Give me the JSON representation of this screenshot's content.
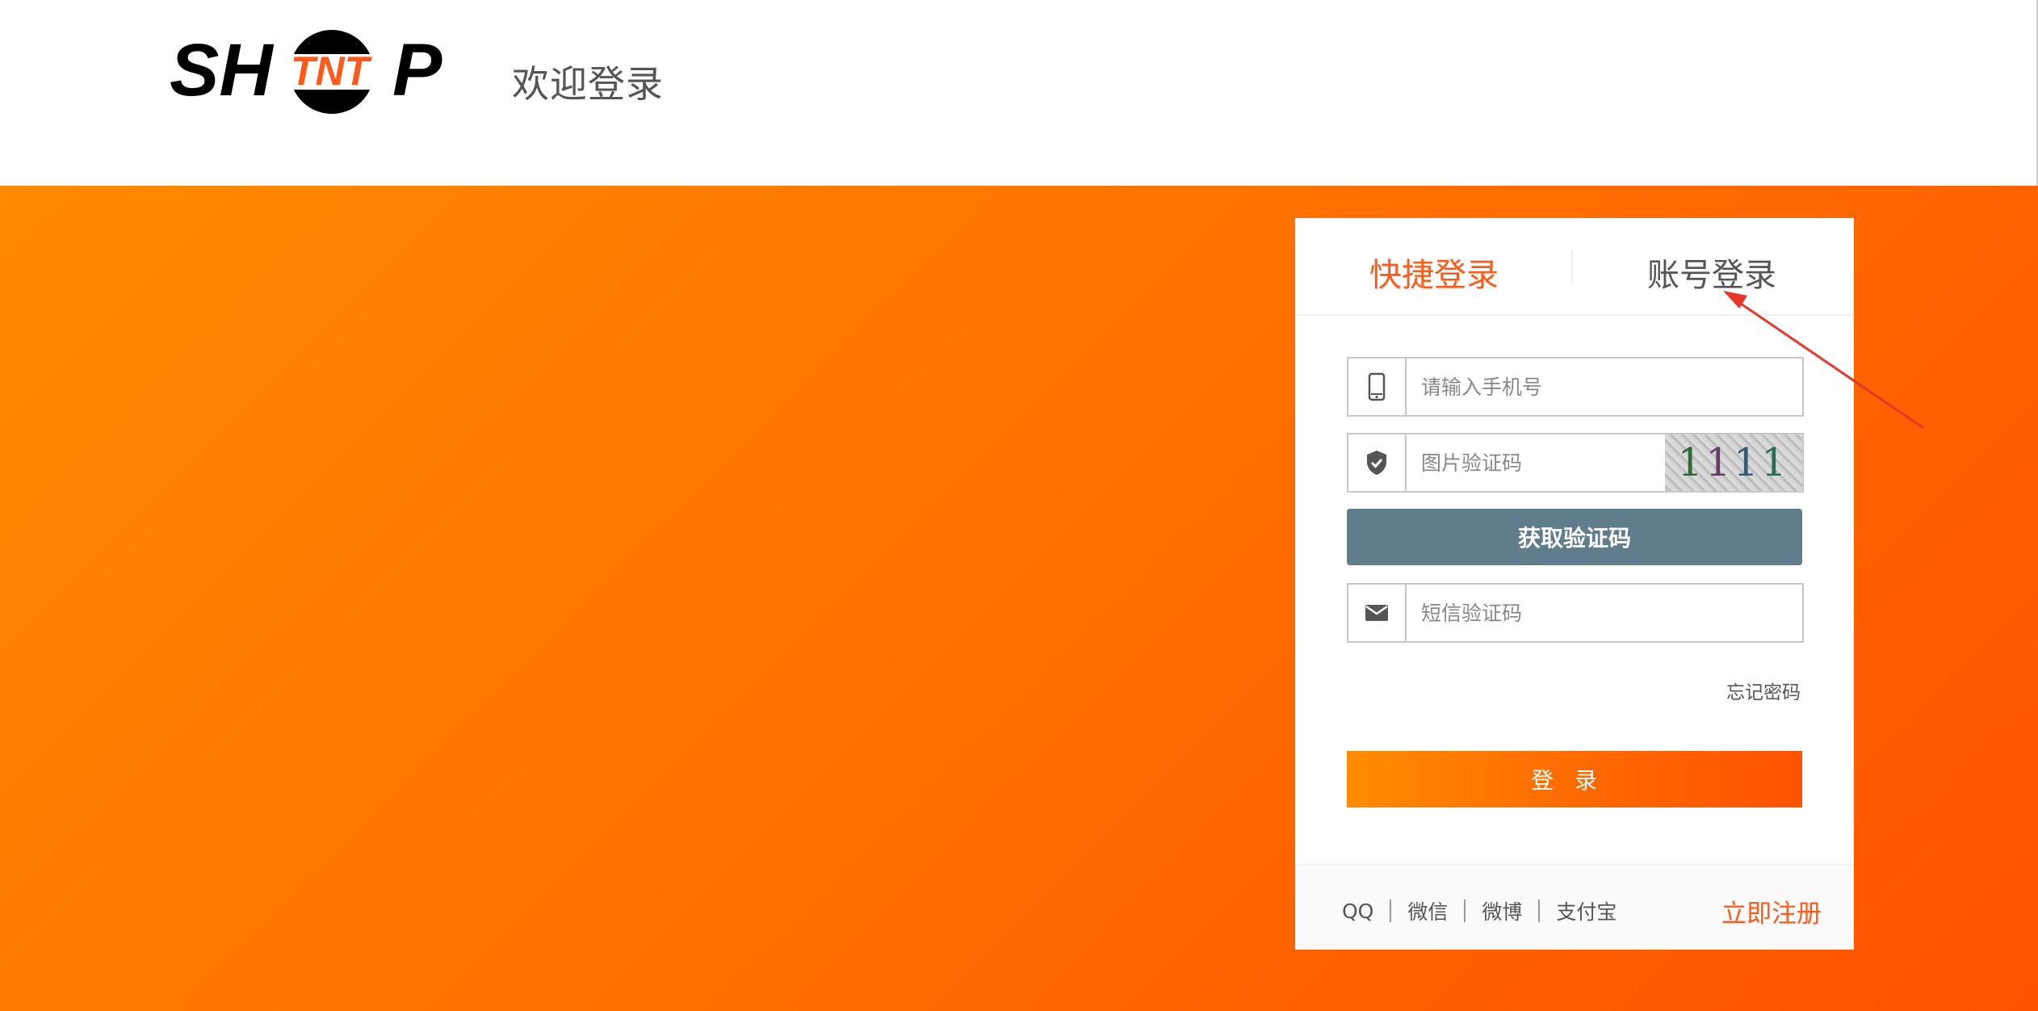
{
  "header": {
    "logo_text": {
      "left": "SH",
      "middle": "TNT",
      "right": "P"
    },
    "welcome": "欢迎登录"
  },
  "colors": {
    "accent": "#ff5a1a",
    "button_gray": "#607d8b",
    "gradient_start": "#ff8a00",
    "gradient_end": "#ff5200"
  },
  "login": {
    "tabs": [
      {
        "label": "快捷登录",
        "active": true
      },
      {
        "label": "账号登录",
        "active": false
      }
    ],
    "phone": {
      "placeholder": "请输入手机号",
      "icon": "mobile-phone-icon"
    },
    "image_code": {
      "placeholder": "图片验证码",
      "icon": "shield-check-icon",
      "captcha": "1111"
    },
    "get_code_label": "获取验证码",
    "sms": {
      "placeholder": "短信验证码",
      "icon": "envelope-icon"
    },
    "forgot_label": "忘记密码",
    "login_label": "登录",
    "social": [
      "QQ",
      "微信",
      "微博",
      "支付宝"
    ],
    "register_label": "立即注册"
  }
}
